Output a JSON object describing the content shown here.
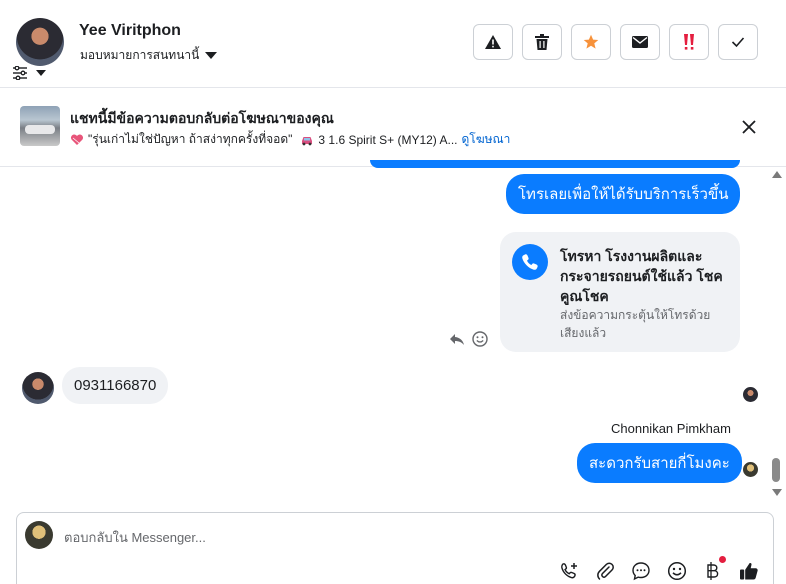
{
  "header": {
    "name": "Yee Viritphon",
    "assign_label": "มอบหมายการสนทนานี้",
    "actions": [
      {
        "icon": "warning-icon",
        "label": ""
      },
      {
        "icon": "trash-icon",
        "label": ""
      },
      {
        "icon": "star-icon",
        "label": ""
      },
      {
        "icon": "mail-icon",
        "label": ""
      },
      {
        "icon": "spam-icon",
        "label": ""
      },
      {
        "icon": "check-icon",
        "label": ""
      }
    ]
  },
  "ad": {
    "title": "แชทนี้มีข้อความตอบกลับต่อโฆษณาของคุณ",
    "subtitle": "\"รุ่นเก่าไม่ใช่ปัญหา ถ้าสง่าทุกครั้งที่จอด\"",
    "car": "3 1.6 Spirit S+ (MY12) A...",
    "link": "ดูโฆษณา"
  },
  "messages": {
    "outgoing1": "โทรเลยเพื่อให้ได้รับบริการเร็วขึ้น",
    "call_card": {
      "title": "โทรหา โรงงานผลิตและกระจายรถยนต์ใช้แล้ว โชคคูณโชค",
      "subtitle": "ส่งข้อความกระตุ้นให้โทรด้วยเสียงแล้ว"
    },
    "incoming1": "0931166870",
    "sender_name": "Chonnikan Pimkham",
    "outgoing2": "สะดวกรับสายกี่โมงคะ"
  },
  "composer": {
    "placeholder": "ตอบกลับใน Messenger..."
  },
  "colors": {
    "accent": "#0a7cff",
    "star": "#f7923b",
    "spam": "#e41e3f",
    "link": "#0064d1"
  }
}
